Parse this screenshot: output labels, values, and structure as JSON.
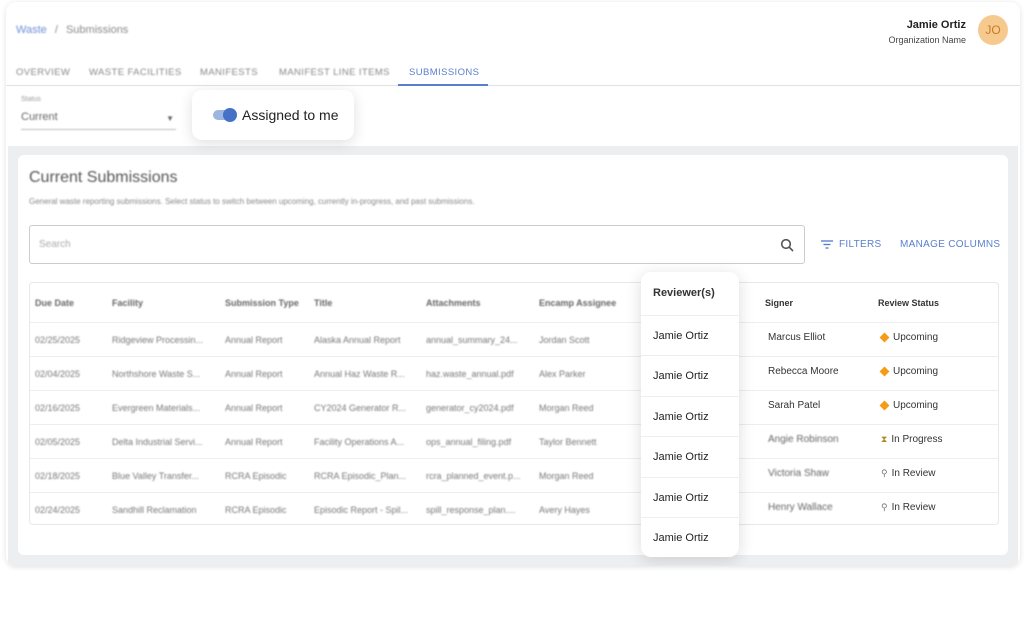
{
  "breadcrumb": {
    "root": "Waste",
    "separator": "/",
    "current": "Submissions"
  },
  "user": {
    "name": "Jamie Ortiz",
    "org": "Organization Name",
    "initials": "JO"
  },
  "tabs": [
    {
      "label": "OVERVIEW"
    },
    {
      "label": "WASTE FACILITIES"
    },
    {
      "label": "MANIFESTS"
    },
    {
      "label": "MANIFEST LINE ITEMS"
    },
    {
      "label": "SUBMISSIONS",
      "active": true
    }
  ],
  "filters": {
    "status_label": "Status",
    "status_value": "Current",
    "assigned_label": "Assigned to me",
    "assigned_on": true
  },
  "card": {
    "title": "Current Submissions",
    "subtitle": "General waste reporting submissions. Select status to switch between upcoming, currently in-progress, and past submissions.",
    "search_placeholder": "Search",
    "filters_button": "FILTERS",
    "manage_columns_button": "MANAGE COLUMNS"
  },
  "table": {
    "columns": [
      "Due Date",
      "Facility",
      "Submission Type",
      "Title",
      "Attachments",
      "Encamp Assignee",
      "Reviewer(s)",
      "Signer",
      "Review Status"
    ],
    "rows": [
      {
        "due": "02/25/2025",
        "facility": "Ridgeview Processin...",
        "type": "Annual Report",
        "title": "Alaska Annual Report",
        "attach": "annual_summary_24...",
        "assignee": "Jordan Scott",
        "reviewer": "Jamie Ortiz",
        "signer": "Marcus Elliot",
        "status": "Upcoming"
      },
      {
        "due": "02/04/2025",
        "facility": "Northshore Waste S...",
        "type": "Annual Report",
        "title": "Annual Haz Waste R...",
        "attach": "haz.waste_annual.pdf",
        "assignee": "Alex Parker",
        "reviewer": "Jamie Ortiz",
        "signer": "Rebecca Moore",
        "status": "Upcoming"
      },
      {
        "due": "02/16/2025",
        "facility": "Evergreen Materials...",
        "type": "Annual Report",
        "title": "CY2024 Generator R...",
        "attach": "generator_cy2024.pdf",
        "assignee": "Morgan Reed",
        "reviewer": "Jamie Ortiz",
        "signer": "Sarah Patel",
        "status": "Upcoming"
      },
      {
        "due": "02/05/2025",
        "facility": "Delta Industrial Servi...",
        "type": "Annual Report",
        "title": "Facility Operations A...",
        "attach": "ops_annual_filing.pdf",
        "assignee": "Taylor Bennett",
        "reviewer": "Jamie Ortiz",
        "signer": "Angie Robinson",
        "status": "In Progress"
      },
      {
        "due": "02/18/2025",
        "facility": "Blue Valley Transfer...",
        "type": "RCRA Episodic",
        "title": "RCRA Episodic_Plan...",
        "attach": "rcra_planned_event.p...",
        "assignee": "Morgan Reed",
        "reviewer": "Jamie Ortiz",
        "signer": "Victoria Shaw",
        "status": "In Review"
      },
      {
        "due": "02/24/2025",
        "facility": "Sandhill Reclamation",
        "type": "RCRA Episodic",
        "title": "Episodic Report - Spil...",
        "attach": "spill_response_plan....",
        "assignee": "Avery Hayes",
        "reviewer": "Jamie Ortiz",
        "signer": "Henry Wallace",
        "status": "In Review"
      }
    ]
  },
  "colors": {
    "accent": "#5a7fcf",
    "upcoming": "#f59b18",
    "avatar_bg": "#f6c98e"
  },
  "icons": {
    "search": "search-icon",
    "filter": "filter-icon",
    "caret": "chevron-down-icon"
  }
}
